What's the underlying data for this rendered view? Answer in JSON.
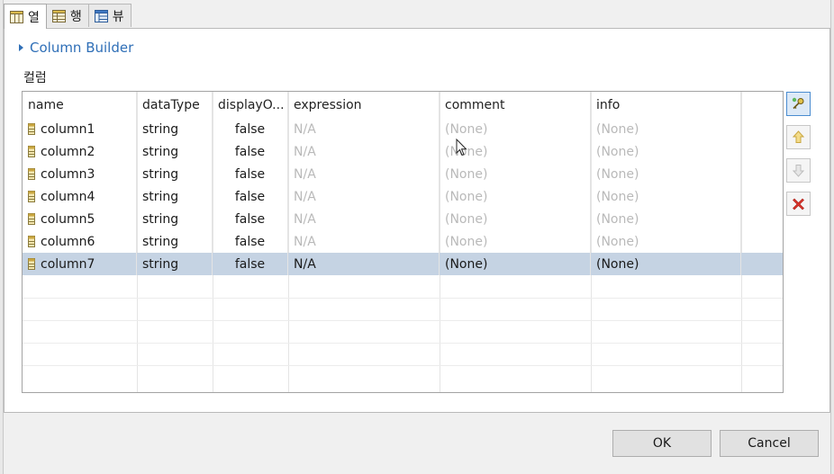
{
  "tabs": [
    {
      "label": "열",
      "icon": "table-columns-icon"
    },
    {
      "label": "행",
      "icon": "table-rows-icon"
    },
    {
      "label": "뷰",
      "icon": "view-icon"
    }
  ],
  "builder": {
    "label": "Column Builder",
    "icon": "collapsed-triangle-icon"
  },
  "section": {
    "label": "컬럼"
  },
  "table": {
    "headers": {
      "name": "name",
      "dataType": "dataType",
      "displayOnly": "displayO...",
      "expression": "expression",
      "comment": "comment",
      "info": "info"
    },
    "rows": [
      {
        "name": "column1",
        "dataType": "string",
        "displayOnly": "false",
        "expression": "N/A",
        "comment": "(None)",
        "info": "(None)"
      },
      {
        "name": "column2",
        "dataType": "string",
        "displayOnly": "false",
        "expression": "N/A",
        "comment": "(None)",
        "info": "(None)"
      },
      {
        "name": "column3",
        "dataType": "string",
        "displayOnly": "false",
        "expression": "N/A",
        "comment": "(None)",
        "info": "(None)"
      },
      {
        "name": "column4",
        "dataType": "string",
        "displayOnly": "false",
        "expression": "N/A",
        "comment": "(None)",
        "info": "(None)"
      },
      {
        "name": "column5",
        "dataType": "string",
        "displayOnly": "false",
        "expression": "N/A",
        "comment": "(None)",
        "info": "(None)"
      },
      {
        "name": "column6",
        "dataType": "string",
        "displayOnly": "false",
        "expression": "N/A",
        "comment": "(None)",
        "info": "(None)"
      },
      {
        "name": "column7",
        "dataType": "string",
        "displayOnly": "false",
        "expression": "N/A",
        "comment": "(None)",
        "info": "(None)",
        "selected": true
      }
    ]
  },
  "side_buttons": [
    {
      "icon": "add-key-icon",
      "active": true
    },
    {
      "icon": "arrow-up-icon",
      "active": false
    },
    {
      "icon": "arrow-down-icon",
      "active": false
    },
    {
      "icon": "delete-icon",
      "active": false
    }
  ],
  "footer": {
    "ok_label": "OK",
    "cancel_label": "Cancel"
  },
  "colors": {
    "accent": "#2f6fb7",
    "selected_row": "#c5d3e3",
    "muted_text": "#b9b9b9",
    "delete_red": "#d9332b"
  }
}
